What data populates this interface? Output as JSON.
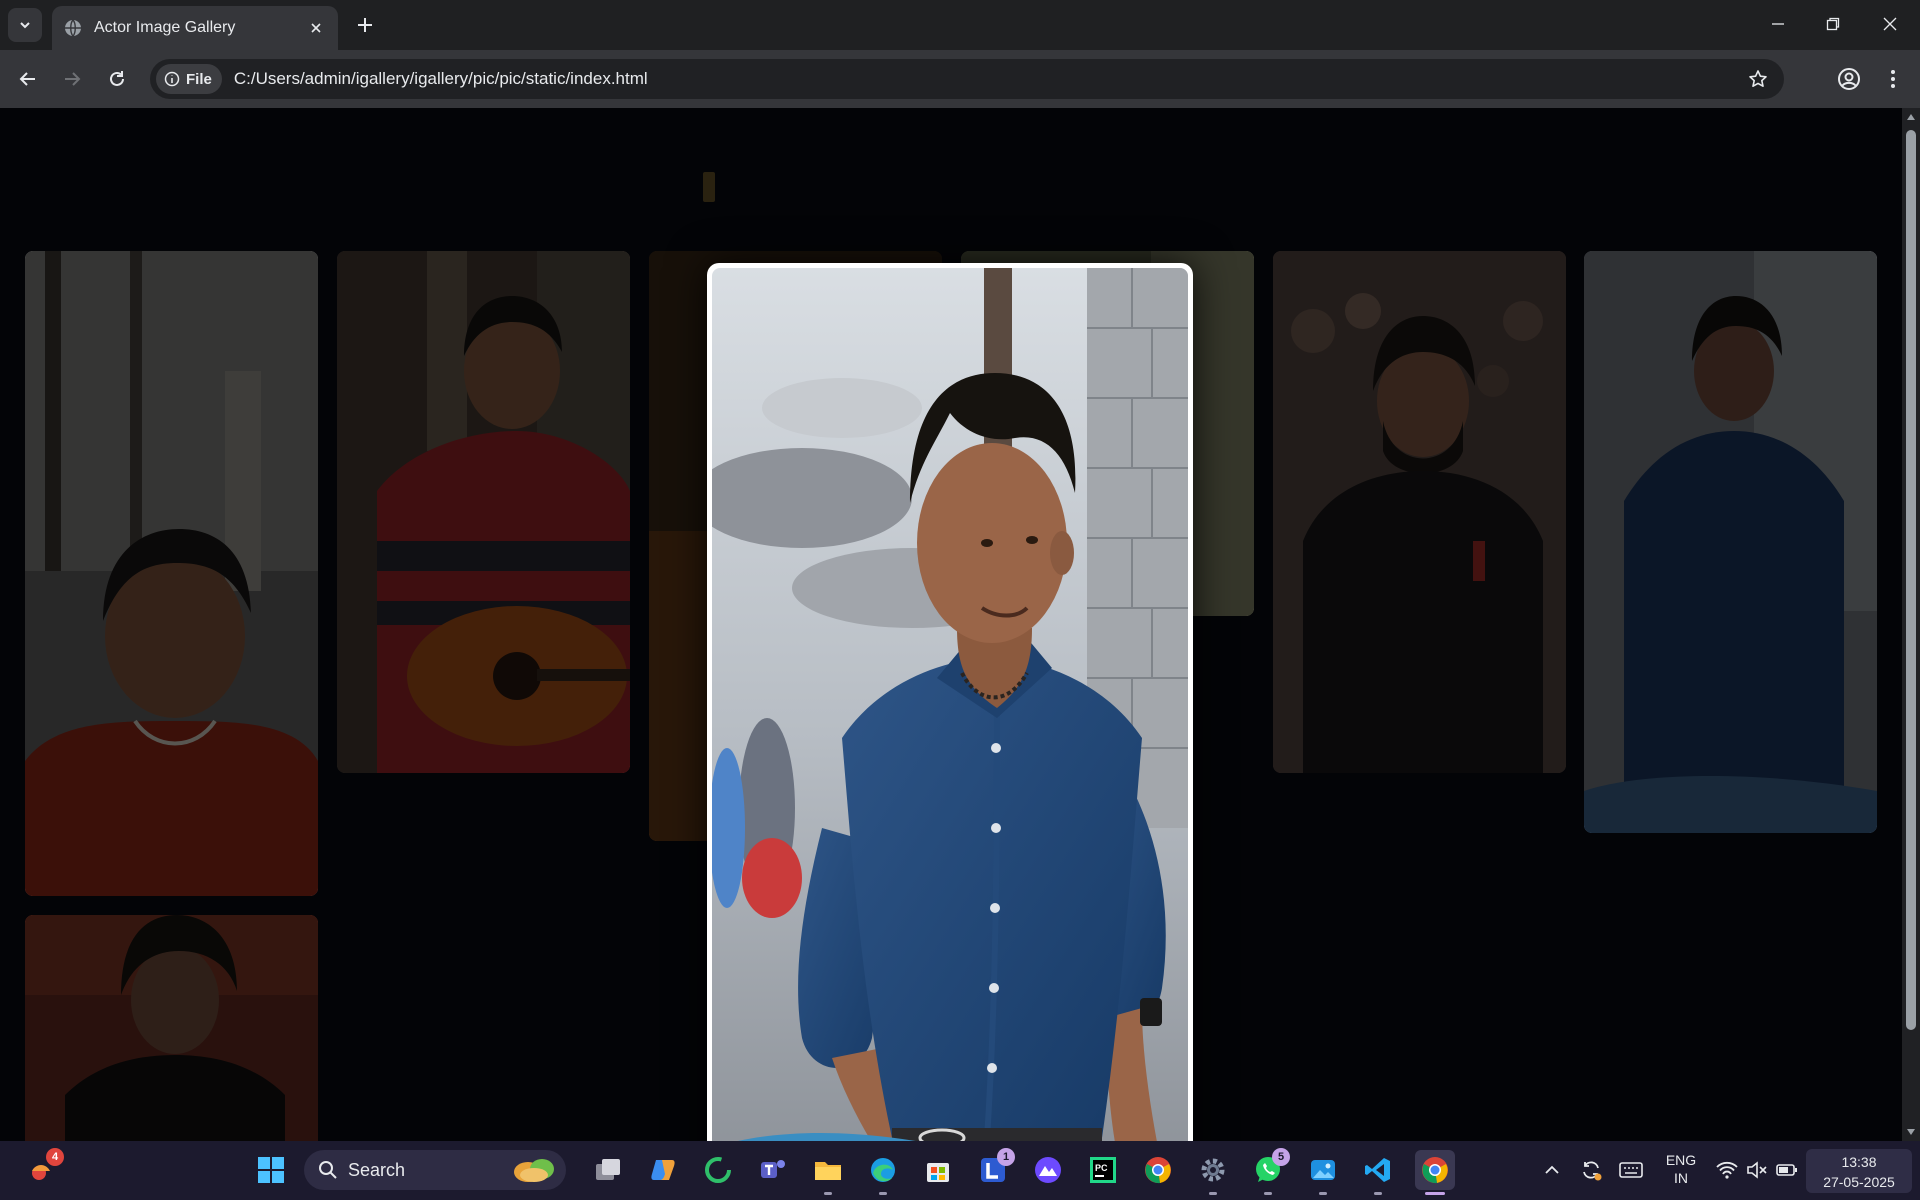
{
  "browser": {
    "tab_title": "Actor Image Gallery",
    "chip_label": "File",
    "url": "C:/Users/admin/igallery/igallery/pic/pic/static/index.html"
  },
  "gallery": {
    "thumbnails": [
      {
        "subject": "actor in red sweater smiling"
      },
      {
        "subject": "actor in red striped shirt with guitar"
      },
      {
        "subject": "partially hidden photo"
      },
      {
        "subject": "partially hidden photo"
      },
      {
        "subject": "bearded actor in black blazer seated"
      },
      {
        "subject": "actor in navy shirt outdoors"
      },
      {
        "subject": "actor with long hair hand on chin"
      }
    ],
    "modal": {
      "subject": "actor in navy blue shirt, hands in pockets"
    }
  },
  "taskbar": {
    "search_label": "Search",
    "badges": {
      "weather": "4",
      "lens": "1",
      "whatsapp": "5"
    },
    "tray": {
      "lang": "ENG",
      "region": "IN"
    },
    "clock": {
      "time": "13:38",
      "date": "27-05-2025"
    }
  }
}
